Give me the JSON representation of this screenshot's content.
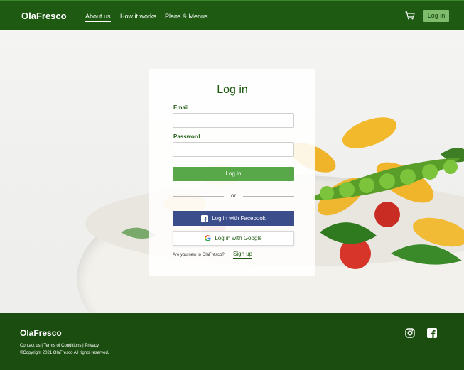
{
  "navbar": {
    "brand": "OlaFresco",
    "links": [
      "About us",
      "How it works",
      "Plans & Menus"
    ],
    "login_label": "Log in",
    "cart_icon": "shopping-cart-icon"
  },
  "login_card": {
    "title": "Log in",
    "email_label": "Email",
    "email_value": "",
    "password_label": "Password",
    "password_value": "",
    "submit_label": "Log in",
    "divider": "or",
    "facebook_label": "Log in with Facebook",
    "google_label": "Log in with Google",
    "signup_question": "Are you new to OlaFresco?",
    "signup_label": "Sign up"
  },
  "footer": {
    "brand": "OlaFresco",
    "links_line": "Contact us | Terms of Conditions | Privacy",
    "copyright": "©Copyright 2021 OlaFresco All rights reserved.",
    "social_icons": [
      "instagram-icon",
      "facebook-icon"
    ]
  },
  "colors": {
    "brand_green": "#1e5a12",
    "button_green": "#58a84a",
    "nav_login_bg": "#7fbd6d",
    "facebook_blue": "#3c4d8c",
    "footer_bg": "#1a4d0f"
  }
}
